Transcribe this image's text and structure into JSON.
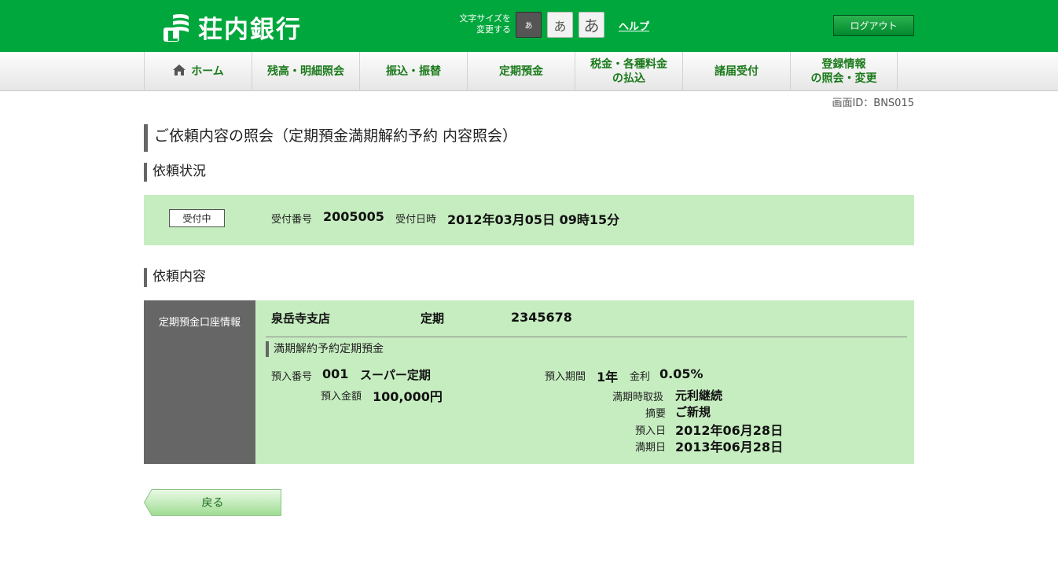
{
  "header": {
    "logo_text": "荘内銀行",
    "fontsize_label_line1": "文字サイズを",
    "fontsize_label_line2": "変更する",
    "fontsize_options": [
      "あ",
      "あ",
      "あ"
    ],
    "help_label": "ヘルプ",
    "logout_label": "ログアウト",
    "brand_color": "#00a73c"
  },
  "nav": {
    "items": [
      {
        "label": "ホーム",
        "label2": ""
      },
      {
        "label": "残高・明細照会",
        "label2": ""
      },
      {
        "label": "振込・振替",
        "label2": ""
      },
      {
        "label": "定期預金",
        "label2": ""
      },
      {
        "label": "税金・各種料金",
        "label2": "の払込"
      },
      {
        "label": "諸届受付",
        "label2": ""
      },
      {
        "label": "登録情報",
        "label2": "の照会・変更"
      }
    ]
  },
  "screen_id": "画面ID：BNS015",
  "page_title": "ご依頼内容の照会（定期預金満期解約予約 内容照会）",
  "status_section": {
    "title": "依頼状況",
    "badge": "受付中",
    "receipt_no_label": "受付番号",
    "receipt_no": "2005005",
    "receipt_date_label": "受付日時",
    "receipt_date": "2012年03月05日 09時15分"
  },
  "detail_section": {
    "title": "依頼内容",
    "side_label": "定期預金口座情報",
    "branch": "泉岳寺支店",
    "account_type": "定期",
    "account_no": "2345678",
    "sub_title": "満期解約予約定期預金",
    "deposit_no_label": "預入番号",
    "deposit_no": "001",
    "product": "スーパー定期",
    "amount_label": "預入金額",
    "amount": "100,000円",
    "period_label": "預入期間",
    "period": "1年",
    "rate_label": "金利",
    "rate": "0.05%",
    "maturity_handling_label": "満期時取扱",
    "maturity_handling": "元利継続",
    "summary_label": "摘要",
    "summary": "ご新規",
    "deposit_date_label": "預入日",
    "deposit_date": "2012年06月28日",
    "maturity_date_label": "満期日",
    "maturity_date": "2013年06月28日"
  },
  "back_button": "戻る"
}
